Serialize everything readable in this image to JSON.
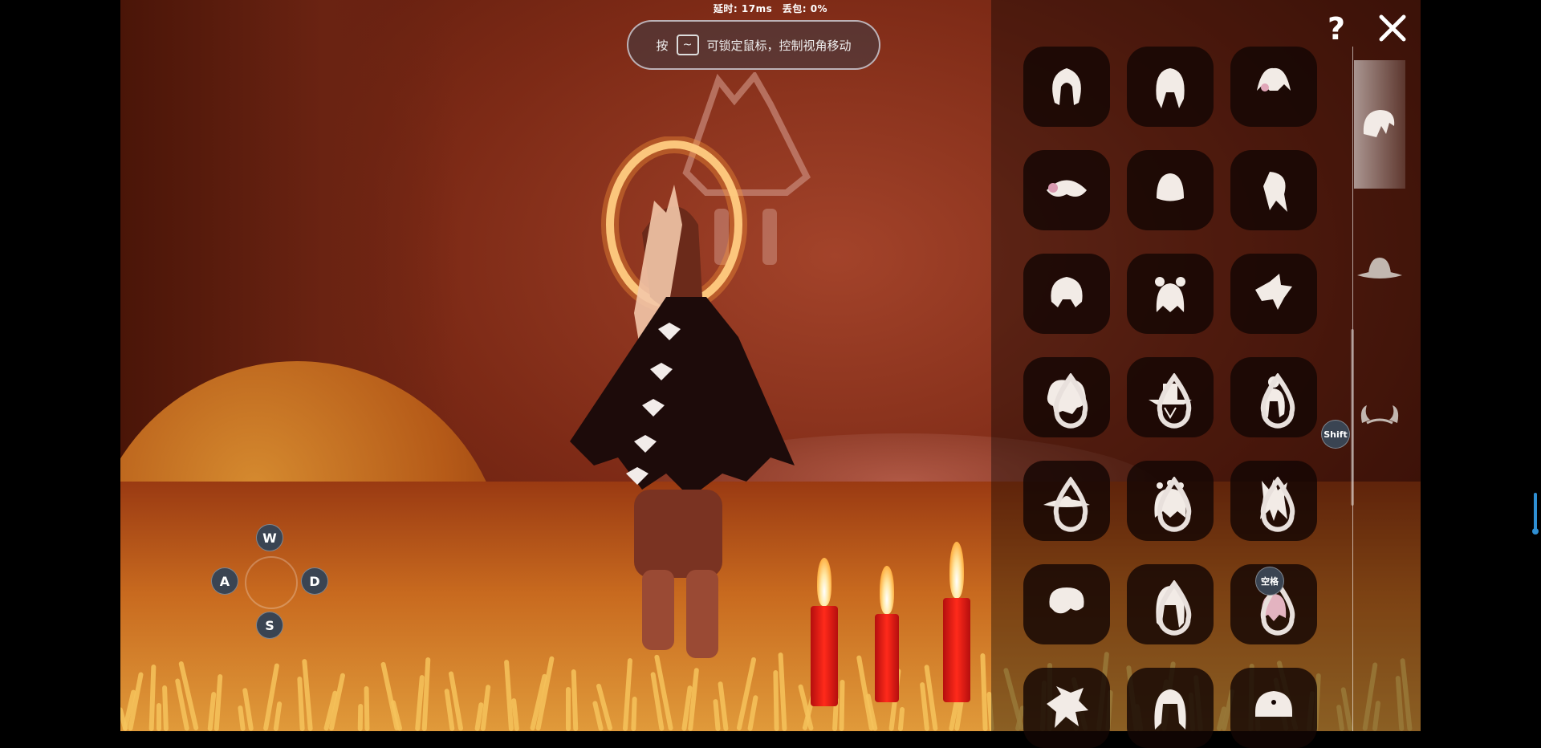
{
  "colors": {
    "accent": "#2f8fd3",
    "slot_bg": "#140604",
    "keycap_bg": "#3a4452"
  },
  "netstat": {
    "text": "延时: 17ms　丢包: 0%"
  },
  "hint": {
    "prefix": "按",
    "key": "~",
    "message": "可锁定鼠标，控制视角移动"
  },
  "topbar": {
    "help_icon": "question-icon",
    "close_icon": "close-icon"
  },
  "movement": {
    "up": "W",
    "left": "A",
    "right": "D",
    "down": "S"
  },
  "key_badges": {
    "shift": "Shift",
    "space": "空格"
  },
  "categories": [
    {
      "icon": "hair-icon",
      "selected": true
    },
    {
      "icon": "hat-icon",
      "selected": false
    },
    {
      "icon": "horns-icon",
      "selected": false
    }
  ],
  "items": [
    {
      "icon": "hair-bob-icon",
      "candle": false
    },
    {
      "icon": "hair-braids-icon",
      "candle": false
    },
    {
      "icon": "hair-pigtails-icon",
      "candle": false
    },
    {
      "icon": "hair-ears-icon",
      "candle": false
    },
    {
      "icon": "hair-short-icon",
      "candle": false
    },
    {
      "icon": "hair-ponytail-icon",
      "candle": false
    },
    {
      "icon": "hair-curly-bun-icon",
      "candle": false
    },
    {
      "icon": "hair-double-bun-icon",
      "candle": false
    },
    {
      "icon": "hair-spiky-icon",
      "candle": false
    },
    {
      "icon": "hair-afro-icon",
      "candle": true
    },
    {
      "icon": "hat-wide-brim-icon",
      "candle": true
    },
    {
      "icon": "hair-top-bun-icon",
      "candle": true
    },
    {
      "icon": "hat-straw-icon",
      "candle": true
    },
    {
      "icon": "hair-flower-crown-icon",
      "candle": true
    },
    {
      "icon": "hair-palm-icon",
      "candle": true
    },
    {
      "icon": "hair-messy-icon",
      "candle": false
    },
    {
      "icon": "hair-long-braids-icon",
      "candle": true
    },
    {
      "icon": "hair-twin-tails-icon",
      "candle": true
    },
    {
      "icon": "hair-wild-icon",
      "candle": false
    },
    {
      "icon": "hair-wavy-icon",
      "candle": false
    },
    {
      "icon": "hat-captain-icon",
      "candle": false
    }
  ]
}
